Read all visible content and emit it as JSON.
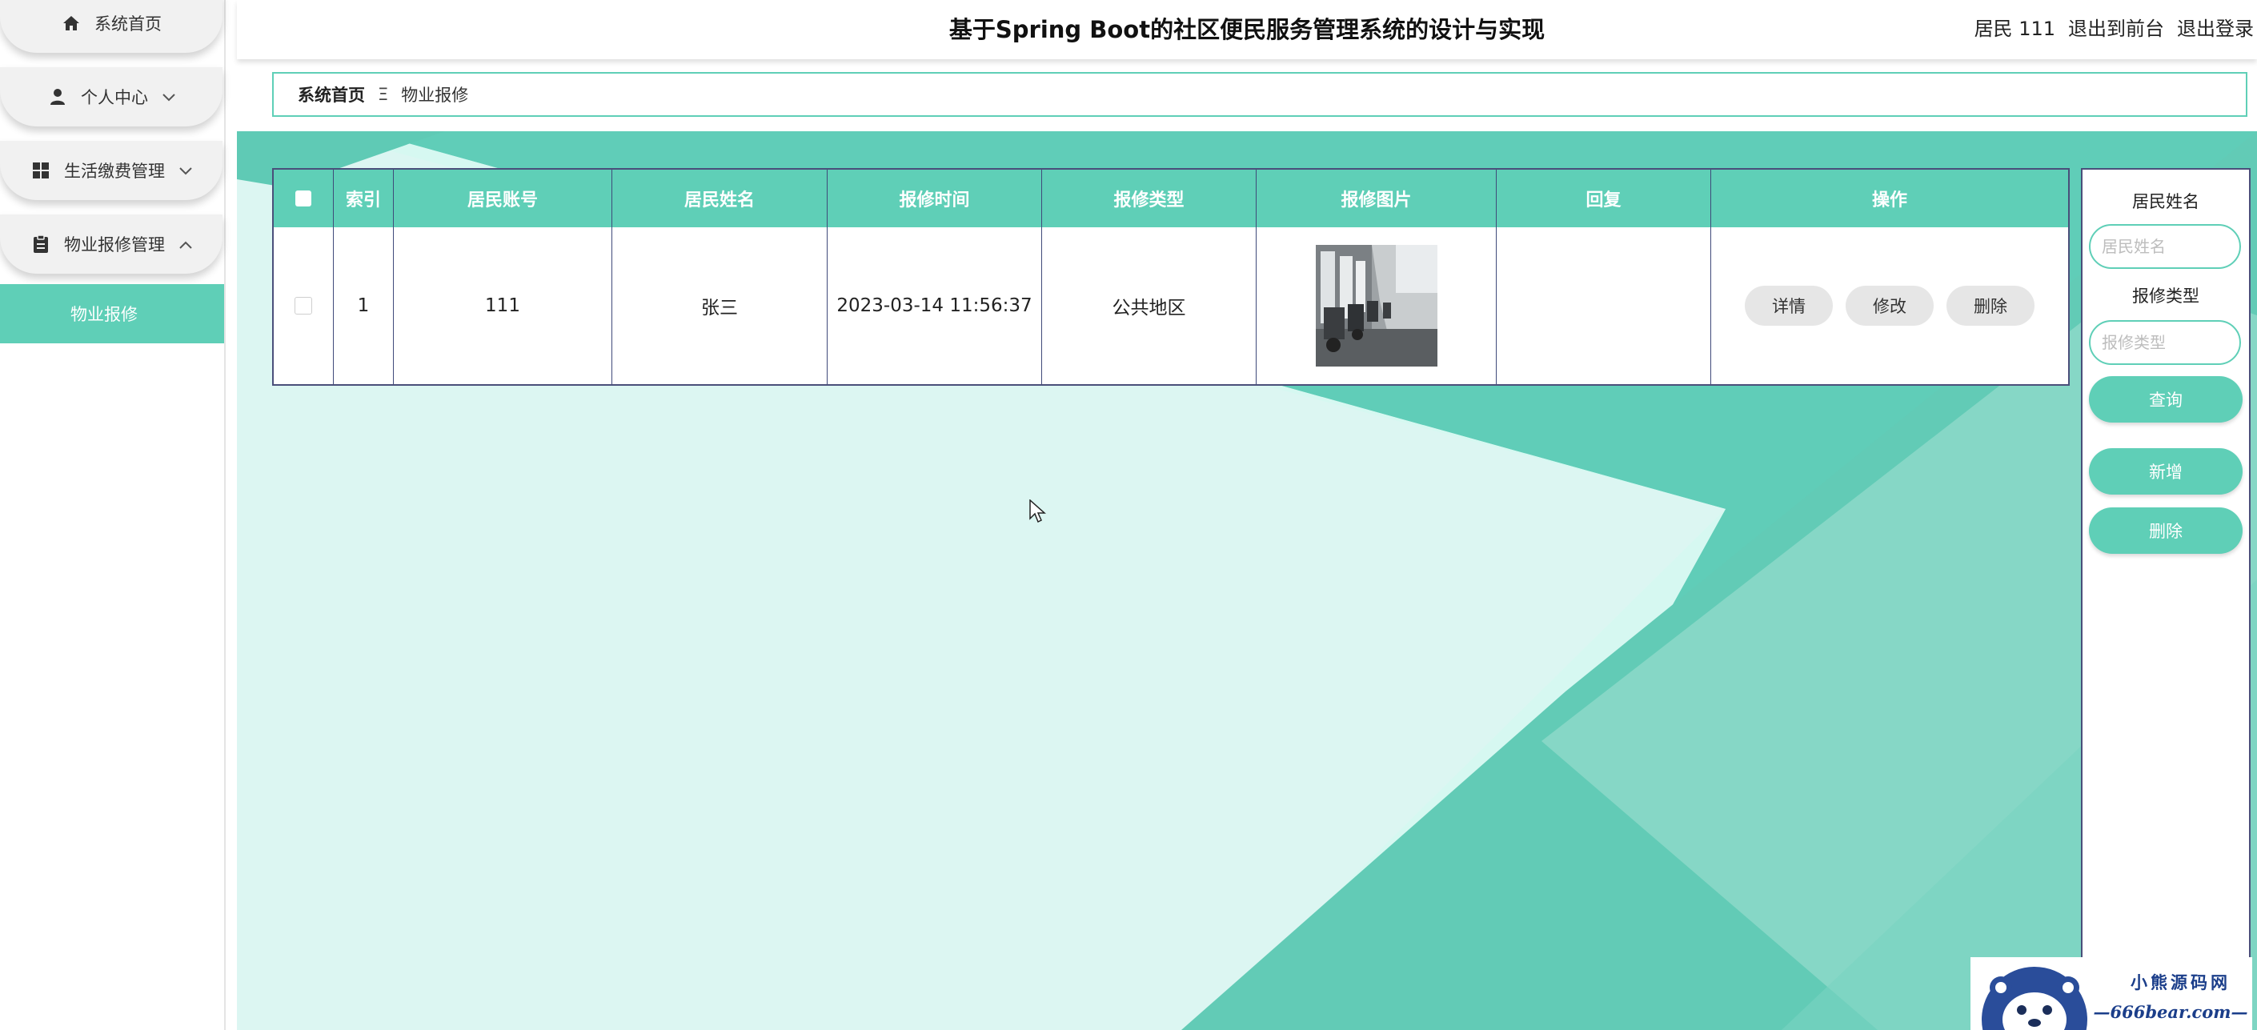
{
  "sidebar": {
    "items": [
      {
        "label": "系统首页",
        "icon": "home-icon"
      },
      {
        "label": "个人中心",
        "icon": "user-icon"
      },
      {
        "label": "生活缴费管理",
        "icon": "grid-icon"
      },
      {
        "label": "物业报修管理",
        "icon": "clipboard-icon"
      }
    ],
    "active_sub": "物业报修"
  },
  "header": {
    "title": "基于Spring Boot的社区便民服务管理系统的设计与实现",
    "user": "居民 111",
    "to_front": "退出到前台",
    "logout": "退出登录"
  },
  "breadcrumb": {
    "home": "系统首页",
    "separator": "Ξ",
    "current": "物业报修"
  },
  "table": {
    "columns": [
      "索引",
      "居民账号",
      "居民姓名",
      "报修时间",
      "报修类型",
      "报修图片",
      "回复",
      "操作"
    ],
    "rows": [
      {
        "index": "1",
        "account": "111",
        "name": "张三",
        "time": "2023-03-14 11:56:37",
        "type": "公共地区",
        "reply": "",
        "actions": [
          "详情",
          "修改",
          "删除"
        ]
      }
    ]
  },
  "search": {
    "name_label": "居民姓名",
    "name_placeholder": "居民姓名",
    "type_label": "报修类型",
    "type_placeholder": "报修类型",
    "query": "查询",
    "add": "新增",
    "delete": "删除"
  },
  "watermark": {
    "line1": "小熊源码网",
    "line2": "—666bear.com—"
  },
  "colors": {
    "accent": "#5fcfb7",
    "table_border": "#4a4f7a"
  }
}
